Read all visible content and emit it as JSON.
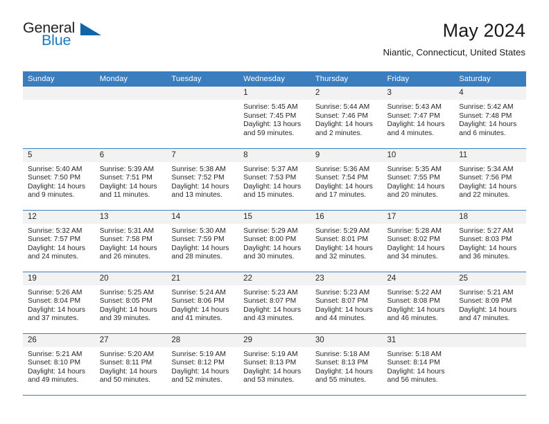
{
  "brand": {
    "name_part1": "General",
    "name_part2": "Blue",
    "triangle_color": "#1065a8",
    "blue_color": "#1878be"
  },
  "header": {
    "title": "May 2024",
    "subtitle": "Niantic, Connecticut, United States"
  },
  "theme": {
    "header_bg": "#3a7ec0",
    "header_text": "#ffffff",
    "daynum_bg": "#f2f2f2",
    "row_divider": "#3a7ec0"
  },
  "weekdays": [
    "Sunday",
    "Monday",
    "Tuesday",
    "Wednesday",
    "Thursday",
    "Friday",
    "Saturday"
  ],
  "weeks": [
    [
      {
        "day": "",
        "sunrise": "",
        "sunset": "",
        "daylight": ""
      },
      {
        "day": "",
        "sunrise": "",
        "sunset": "",
        "daylight": ""
      },
      {
        "day": "",
        "sunrise": "",
        "sunset": "",
        "daylight": ""
      },
      {
        "day": "1",
        "sunrise": "Sunrise: 5:45 AM",
        "sunset": "Sunset: 7:45 PM",
        "daylight": "Daylight: 13 hours and 59 minutes."
      },
      {
        "day": "2",
        "sunrise": "Sunrise: 5:44 AM",
        "sunset": "Sunset: 7:46 PM",
        "daylight": "Daylight: 14 hours and 2 minutes."
      },
      {
        "day": "3",
        "sunrise": "Sunrise: 5:43 AM",
        "sunset": "Sunset: 7:47 PM",
        "daylight": "Daylight: 14 hours and 4 minutes."
      },
      {
        "day": "4",
        "sunrise": "Sunrise: 5:42 AM",
        "sunset": "Sunset: 7:48 PM",
        "daylight": "Daylight: 14 hours and 6 minutes."
      }
    ],
    [
      {
        "day": "5",
        "sunrise": "Sunrise: 5:40 AM",
        "sunset": "Sunset: 7:50 PM",
        "daylight": "Daylight: 14 hours and 9 minutes."
      },
      {
        "day": "6",
        "sunrise": "Sunrise: 5:39 AM",
        "sunset": "Sunset: 7:51 PM",
        "daylight": "Daylight: 14 hours and 11 minutes."
      },
      {
        "day": "7",
        "sunrise": "Sunrise: 5:38 AM",
        "sunset": "Sunset: 7:52 PM",
        "daylight": "Daylight: 14 hours and 13 minutes."
      },
      {
        "day": "8",
        "sunrise": "Sunrise: 5:37 AM",
        "sunset": "Sunset: 7:53 PM",
        "daylight": "Daylight: 14 hours and 15 minutes."
      },
      {
        "day": "9",
        "sunrise": "Sunrise: 5:36 AM",
        "sunset": "Sunset: 7:54 PM",
        "daylight": "Daylight: 14 hours and 17 minutes."
      },
      {
        "day": "10",
        "sunrise": "Sunrise: 5:35 AM",
        "sunset": "Sunset: 7:55 PM",
        "daylight": "Daylight: 14 hours and 20 minutes."
      },
      {
        "day": "11",
        "sunrise": "Sunrise: 5:34 AM",
        "sunset": "Sunset: 7:56 PM",
        "daylight": "Daylight: 14 hours and 22 minutes."
      }
    ],
    [
      {
        "day": "12",
        "sunrise": "Sunrise: 5:32 AM",
        "sunset": "Sunset: 7:57 PM",
        "daylight": "Daylight: 14 hours and 24 minutes."
      },
      {
        "day": "13",
        "sunrise": "Sunrise: 5:31 AM",
        "sunset": "Sunset: 7:58 PM",
        "daylight": "Daylight: 14 hours and 26 minutes."
      },
      {
        "day": "14",
        "sunrise": "Sunrise: 5:30 AM",
        "sunset": "Sunset: 7:59 PM",
        "daylight": "Daylight: 14 hours and 28 minutes."
      },
      {
        "day": "15",
        "sunrise": "Sunrise: 5:29 AM",
        "sunset": "Sunset: 8:00 PM",
        "daylight": "Daylight: 14 hours and 30 minutes."
      },
      {
        "day": "16",
        "sunrise": "Sunrise: 5:29 AM",
        "sunset": "Sunset: 8:01 PM",
        "daylight": "Daylight: 14 hours and 32 minutes."
      },
      {
        "day": "17",
        "sunrise": "Sunrise: 5:28 AM",
        "sunset": "Sunset: 8:02 PM",
        "daylight": "Daylight: 14 hours and 34 minutes."
      },
      {
        "day": "18",
        "sunrise": "Sunrise: 5:27 AM",
        "sunset": "Sunset: 8:03 PM",
        "daylight": "Daylight: 14 hours and 36 minutes."
      }
    ],
    [
      {
        "day": "19",
        "sunrise": "Sunrise: 5:26 AM",
        "sunset": "Sunset: 8:04 PM",
        "daylight": "Daylight: 14 hours and 37 minutes."
      },
      {
        "day": "20",
        "sunrise": "Sunrise: 5:25 AM",
        "sunset": "Sunset: 8:05 PM",
        "daylight": "Daylight: 14 hours and 39 minutes."
      },
      {
        "day": "21",
        "sunrise": "Sunrise: 5:24 AM",
        "sunset": "Sunset: 8:06 PM",
        "daylight": "Daylight: 14 hours and 41 minutes."
      },
      {
        "day": "22",
        "sunrise": "Sunrise: 5:23 AM",
        "sunset": "Sunset: 8:07 PM",
        "daylight": "Daylight: 14 hours and 43 minutes."
      },
      {
        "day": "23",
        "sunrise": "Sunrise: 5:23 AM",
        "sunset": "Sunset: 8:07 PM",
        "daylight": "Daylight: 14 hours and 44 minutes."
      },
      {
        "day": "24",
        "sunrise": "Sunrise: 5:22 AM",
        "sunset": "Sunset: 8:08 PM",
        "daylight": "Daylight: 14 hours and 46 minutes."
      },
      {
        "day": "25",
        "sunrise": "Sunrise: 5:21 AM",
        "sunset": "Sunset: 8:09 PM",
        "daylight": "Daylight: 14 hours and 47 minutes."
      }
    ],
    [
      {
        "day": "26",
        "sunrise": "Sunrise: 5:21 AM",
        "sunset": "Sunset: 8:10 PM",
        "daylight": "Daylight: 14 hours and 49 minutes."
      },
      {
        "day": "27",
        "sunrise": "Sunrise: 5:20 AM",
        "sunset": "Sunset: 8:11 PM",
        "daylight": "Daylight: 14 hours and 50 minutes."
      },
      {
        "day": "28",
        "sunrise": "Sunrise: 5:19 AM",
        "sunset": "Sunset: 8:12 PM",
        "daylight": "Daylight: 14 hours and 52 minutes."
      },
      {
        "day": "29",
        "sunrise": "Sunrise: 5:19 AM",
        "sunset": "Sunset: 8:13 PM",
        "daylight": "Daylight: 14 hours and 53 minutes."
      },
      {
        "day": "30",
        "sunrise": "Sunrise: 5:18 AM",
        "sunset": "Sunset: 8:13 PM",
        "daylight": "Daylight: 14 hours and 55 minutes."
      },
      {
        "day": "31",
        "sunrise": "Sunrise: 5:18 AM",
        "sunset": "Sunset: 8:14 PM",
        "daylight": "Daylight: 14 hours and 56 minutes."
      },
      {
        "day": "",
        "sunrise": "",
        "sunset": "",
        "daylight": ""
      }
    ]
  ]
}
